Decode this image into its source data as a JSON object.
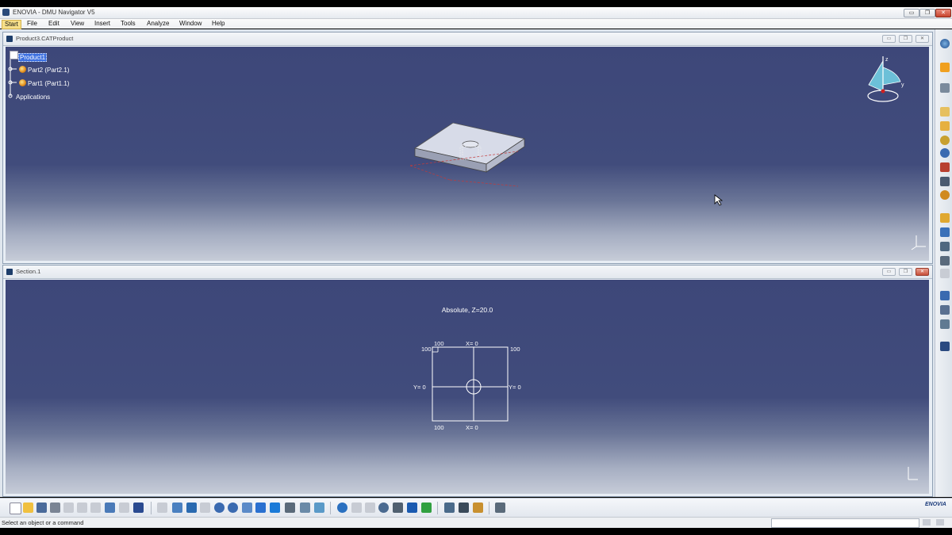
{
  "window": {
    "title": "ENOVIA - DMU Navigator V5",
    "buttons": {
      "minimize": "▭",
      "restore": "❐",
      "close": "✕"
    }
  },
  "menu": {
    "items": [
      "Start",
      "File",
      "Edit",
      "View",
      "Insert",
      "Tools",
      "Analyze",
      "Window",
      "Help"
    ],
    "active": "Start"
  },
  "viewer_top": {
    "title": "Product3.CATProduct",
    "tree": {
      "root": "Product1",
      "children": [
        "Part2 (Part2.1)",
        "Part1 (Part1.1)"
      ],
      "applications": "Applications"
    }
  },
  "viewer_section": {
    "title": "Section.1",
    "plane_label": "Absolute, Z=20.0",
    "grid_labels": {
      "top_left": "100",
      "top_center": "X=   0",
      "left_top": "100",
      "right_top": "100",
      "left_mid": "Y=   0",
      "right_mid": "Y=   0",
      "bottom_left": "100",
      "bottom_center": "X=   0"
    }
  },
  "compass_labels": {
    "z": "z",
    "y": "y"
  },
  "status": {
    "prompt": "Select an object or a command"
  },
  "brand": "ENOVIA",
  "colors": {
    "viewer_bg": "#3d4779",
    "selection": "#3b6fe0",
    "section_lines": "#ffffff"
  }
}
